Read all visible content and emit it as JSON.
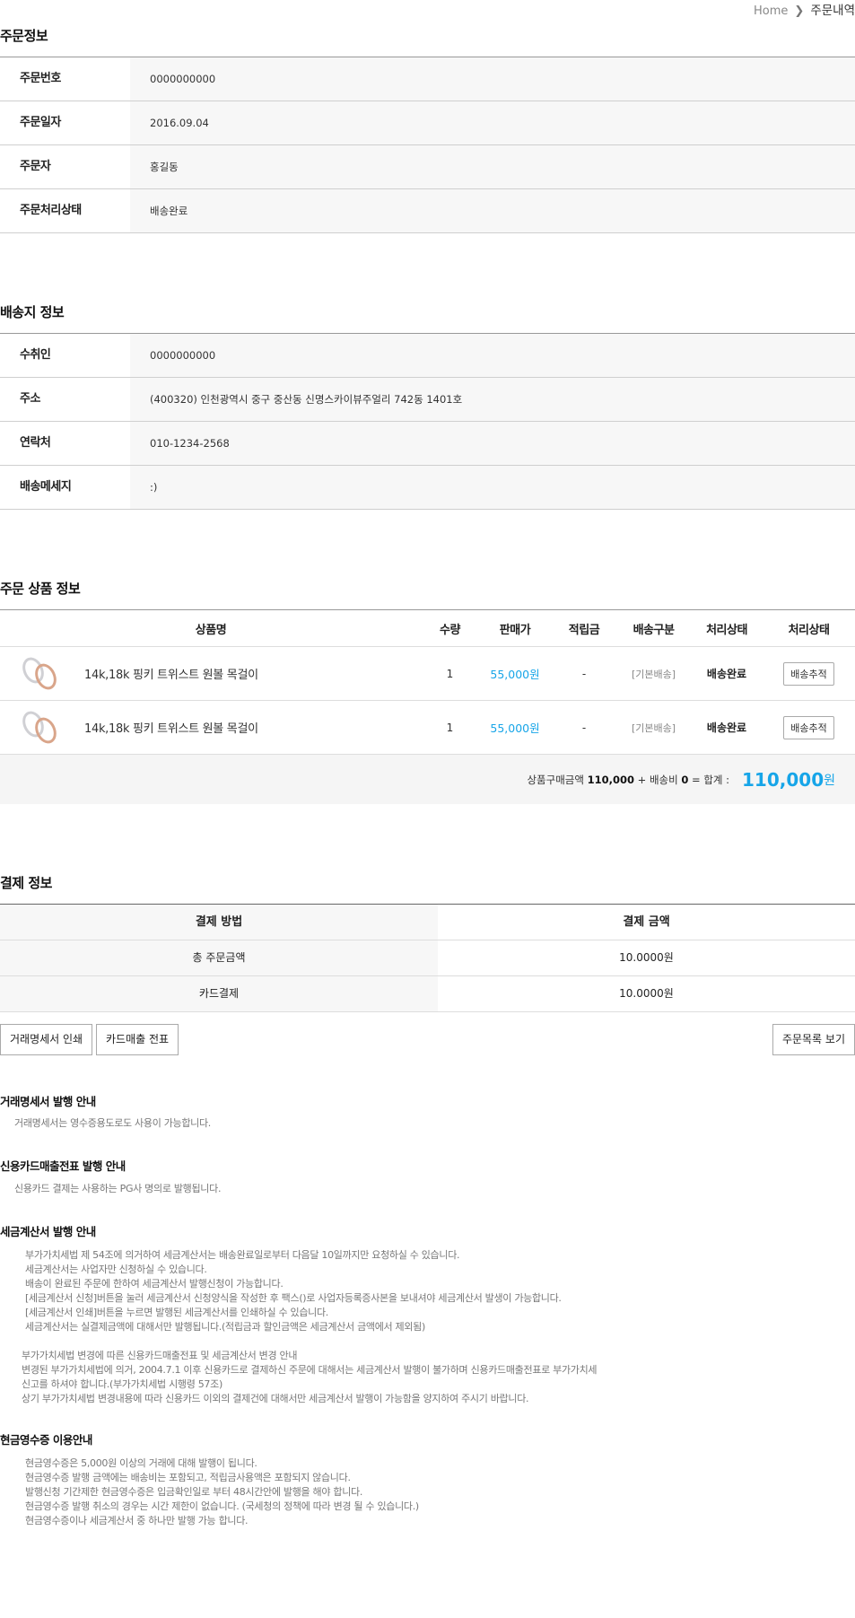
{
  "breadcrumb": {
    "home": "Home",
    "current": "주문내역"
  },
  "order_info": {
    "title": "주문정보",
    "rows": [
      {
        "label": "주문번호",
        "value": "0000000000"
      },
      {
        "label": "주문일자",
        "value": "2016.09.04"
      },
      {
        "label": "주문자",
        "value": "홍길동"
      },
      {
        "label": "주문처리상태",
        "value": "배송완료"
      }
    ]
  },
  "shipping_info": {
    "title": "배송지 정보",
    "rows": [
      {
        "label": "수취인",
        "value": "0000000000"
      },
      {
        "label": "주소",
        "value": "(400320) 인천광역시 중구 중산동 신명스카이뷰주얼리 742동 1401호"
      },
      {
        "label": "연락처",
        "value": "010-1234-2568"
      },
      {
        "label": "배송메세지",
        "value": ":)"
      }
    ]
  },
  "products": {
    "title": "주문 상품 정보",
    "headers": {
      "name": "상품명",
      "qty": "수량",
      "price": "판매가",
      "point": "적립금",
      "ship": "배송구분",
      "status": "처리상태",
      "action": "처리상태"
    },
    "items": [
      {
        "name": "14k,18k 핑키 트위스트 원볼 목걸이",
        "qty": "1",
        "price": "55,000원",
        "point": "-",
        "ship": "[기본배송]",
        "status": "배송완료",
        "action": "배송추적"
      },
      {
        "name": "14k,18k 핑키 트위스트 원볼 목걸이",
        "qty": "1",
        "price": "55,000원",
        "point": "-",
        "ship": "[기본배송]",
        "status": "배송완료",
        "action": "배송추적"
      }
    ],
    "summary": {
      "subtotal_label": "상품구매금액",
      "subtotal": "110,000",
      "plus": "+",
      "shipping_label": "배송비",
      "shipping": "0",
      "equals_label": "= 합계 :",
      "total": "110,000",
      "won": "원"
    }
  },
  "payment": {
    "title": "결제 정보",
    "headers": {
      "method": "결제 방법",
      "amount": "결제 금액"
    },
    "rows": [
      {
        "method": "총 주문금액",
        "amount": "10.0000원"
      },
      {
        "method": "카드결제",
        "amount": "10.0000원"
      }
    ]
  },
  "buttons": {
    "print_statement": "거래명세서 인쇄",
    "card_slip": "카드매출 전표",
    "order_list": "주문목록 보기"
  },
  "notices": {
    "statement": {
      "title": "거래명세서 발행 안내",
      "lines": [
        "거래명세서는 영수증용도로도 사용이 가능합니다."
      ]
    },
    "card": {
      "title": "신용카드매출전표 발행 안내",
      "lines": [
        "신용카드 결제는 사용하는 PG사 명의로 발행됩니다."
      ]
    },
    "tax": {
      "title": "세금계산서 발행 안내",
      "lines": [
        "부가가치세법 제 54조에 의거하여 세금계산서는 배송완료일로부터 다음달 10일까지만 요청하실 수 있습니다.",
        "세금계산서는 사업자만 신청하실 수 있습니다.",
        "배송이 완료된 주문에 한하여 세금계산서 발행신청이 가능합니다.",
        "[세금계산서 신청]버튼을 눌러 세금계산서 신청양식을 작성한 후 팩스()로 사업자등록증사본을 보내셔야 세금계산서 발생이 가능합니다.",
        "[세금계산서 인쇄]버튼을 누르면 발행된 세금계산서를 인쇄하실 수 있습니다.",
        "세금계산서는 실결제금액에 대해서만 발행됩니다.(적립금과 할인금액은 세금계산서 금액에서 제외됨)"
      ],
      "lines2": [
        "부가가치세법 변경에 따른 신용카드매출전표 및 세금계산서 변경 안내",
        "변경된 부가가치세법에 의거, 2004.7.1 이후 신용카드로 결제하신 주문에 대해서는 세금계산서 발행이 불가하며 신용카드매출전표로 부가가치세",
        "신고를 하셔야 합니다.(부가가치세법 시행령 57조)",
        "상기 부가가치세법 변경내용에 따라 신용카드 이외의 결제건에 대해서만 세금계산서 발행이 가능함을 양지하여 주시기 바랍니다."
      ]
    },
    "cash": {
      "title": "현금영수증 이용안내",
      "lines": [
        "현금영수증은 5,000원 이상의 거래에 대해 발행이 됩니다.",
        "현금영수증 발행 금액에는 배송비는 포함되고, 적립금사용액은 포함되지 않습니다.",
        "발행신청 기간제한 현금영수증은 입금확인일로 부터 48시간안에 발행을 해야 합니다.",
        "현금영수증 발행 취소의 경우는 시간 제한이 없습니다. (국세청의 정책에 따라 변경 될 수 있습니다.)",
        "현금영수증이나 세금계산서 중 하나만 발행 가능 합니다."
      ]
    }
  }
}
